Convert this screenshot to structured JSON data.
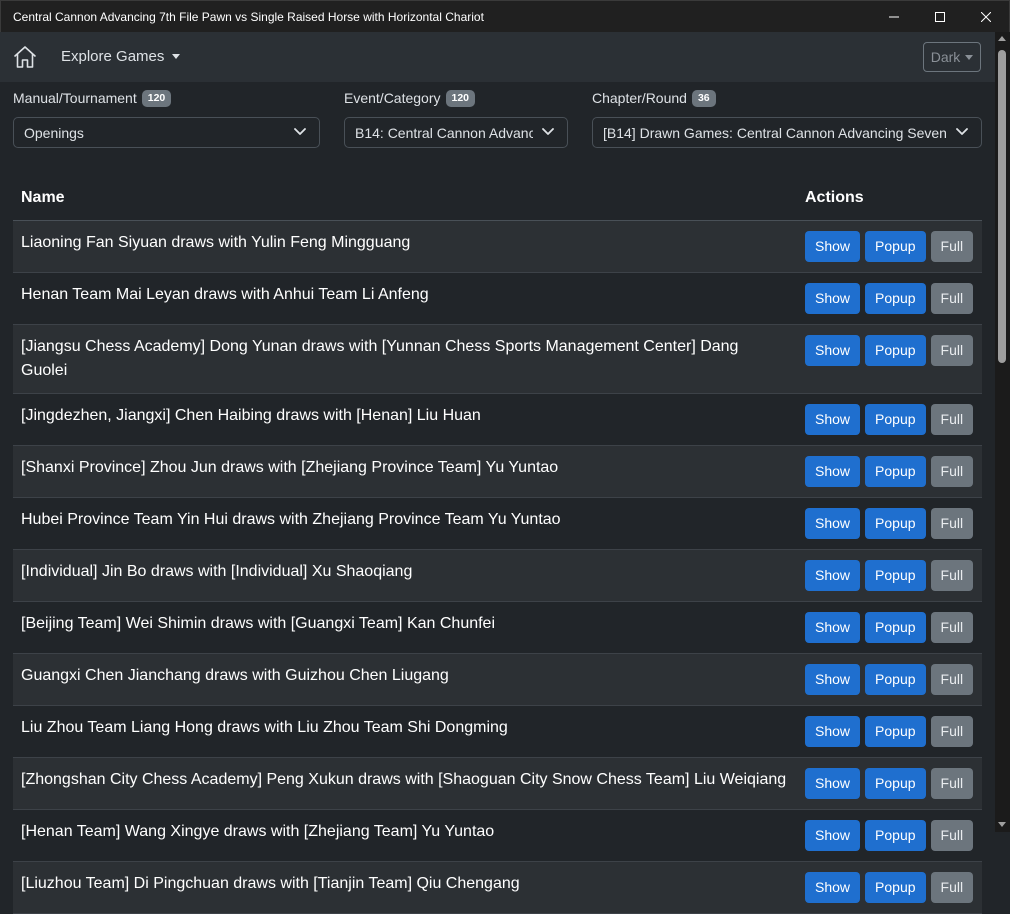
{
  "window": {
    "title": "Central Cannon Advancing 7th File Pawn vs Single Raised Horse with Horizontal Chariot"
  },
  "navbar": {
    "explore_label": "Explore Games",
    "theme_label": "Dark"
  },
  "filters": [
    {
      "label": "Manual/Tournament",
      "count": "120",
      "value": "Openings"
    },
    {
      "label": "Event/Category",
      "count": "120",
      "value": "B14: Central Cannon Advanc"
    },
    {
      "label": "Chapter/Round",
      "count": "36",
      "value": "[B14] Drawn Games: Central Cannon Advancing Seven"
    }
  ],
  "table": {
    "headers": {
      "name": "Name",
      "actions": "Actions"
    },
    "actions": {
      "show": "Show",
      "popup": "Popup",
      "full": "Full"
    },
    "rows": [
      "Liaoning Fan Siyuan draws with Yulin Feng Mingguang",
      "Henan Team Mai Leyan draws with Anhui Team Li Anfeng",
      "[Jiangsu Chess Academy] Dong Yunan draws with [Yunnan Chess Sports Management Center] Dang Guolei",
      "[Jingdezhen, Jiangxi] Chen Haibing draws with [Henan] Liu Huan",
      "[Shanxi Province] Zhou Jun draws with [Zhejiang Province Team] Yu Yuntao",
      "Hubei Province Team Yin Hui draws with Zhejiang Province Team Yu Yuntao",
      "[Individual] Jin Bo draws with [Individual] Xu Shaoqiang",
      "[Beijing Team] Wei Shimin draws with [Guangxi Team] Kan Chunfei",
      "Guangxi Chen Jianchang draws with Guizhou Chen Liugang",
      "Liu Zhou Team Liang Hong draws with Liu Zhou Team Shi Dongming",
      "[Zhongshan City Chess Academy] Peng Xukun draws with [Shaoguan City Snow Chess Team] Liu Weiqiang",
      "[Henan Team] Wang Xingye draws with [Zhejiang Team] Yu Yuntao",
      "[Liuzhou Team] Di Pingchuan draws with [Tianjin Team] Qiu Chengang"
    ]
  },
  "icons": {
    "home": "home-icon",
    "minimize": "minimize-icon",
    "maximize": "maximize-icon",
    "close": "close-icon",
    "chevron": "chevron-down-icon"
  },
  "colors": {
    "primary_button": "#1f6fcf",
    "secondary_button": "#6c757d",
    "background": "#212529",
    "navbar": "#2b3035"
  }
}
